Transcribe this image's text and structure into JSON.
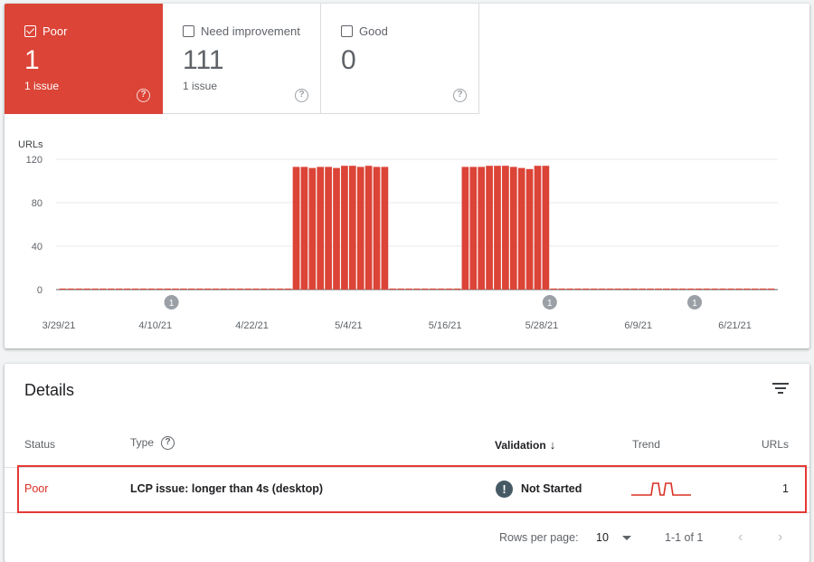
{
  "tiles": [
    {
      "label": "Poor",
      "count": "1",
      "sub": "1 issue",
      "active": true
    },
    {
      "label": "Need improvement",
      "count": "111",
      "sub": "1 issue",
      "active": false
    },
    {
      "label": "Good",
      "count": "0",
      "sub": "",
      "active": false
    }
  ],
  "help_glyph": "?",
  "colors": {
    "poor": "#db4437",
    "accent": "#d93025"
  },
  "chart_data": {
    "type": "bar",
    "ylabel": "URLs",
    "ylim": [
      0,
      120
    ],
    "yticks": [
      0,
      40,
      80,
      120
    ],
    "x_tick_labels": [
      "3/29/21",
      "4/10/21",
      "4/22/21",
      "5/4/21",
      "5/16/21",
      "5/28/21",
      "6/9/21",
      "6/21/21"
    ],
    "start_date": "3/29/21",
    "series": [
      {
        "values": [
          1,
          1,
          1,
          1,
          1,
          1,
          1,
          1,
          1,
          1,
          1,
          1,
          1,
          1,
          1,
          1,
          1,
          1,
          1,
          1,
          1,
          1,
          1,
          1,
          1,
          1,
          1,
          1,
          1,
          113,
          113,
          112,
          113,
          113,
          112,
          114,
          114,
          113,
          114,
          113,
          113,
          1,
          1,
          1,
          1,
          1,
          1,
          1,
          1,
          1,
          113,
          113,
          113,
          114,
          114,
          114,
          113,
          112,
          111,
          114,
          114,
          1,
          1,
          1,
          1,
          1,
          1,
          1,
          1,
          1,
          1,
          1,
          1,
          1,
          1,
          1,
          1,
          1,
          1,
          1,
          1,
          1,
          1,
          1,
          1,
          1,
          1,
          1,
          1
        ]
      }
    ],
    "annotations": [
      {
        "label": "1",
        "date": "4/12/21"
      },
      {
        "label": "1",
        "date": "5/29/21"
      },
      {
        "label": "1",
        "date": "6/16/21"
      }
    ]
  },
  "details": {
    "title": "Details",
    "headers": {
      "status": "Status",
      "type": "Type",
      "validation": "Validation",
      "trend": "Trend",
      "urls": "URLs"
    },
    "row": {
      "status": "Poor",
      "type": "LCP issue: longer than 4s (desktop)",
      "validation": "Not Started",
      "urls": "1"
    },
    "footer": {
      "rows_per_page_label": "Rows per page:",
      "rows_per_page": "10",
      "range": "1-1 of 1"
    },
    "warn_glyph": "!",
    "sort_glyph": "↓",
    "prev_glyph": "‹",
    "next_glyph": "›"
  }
}
